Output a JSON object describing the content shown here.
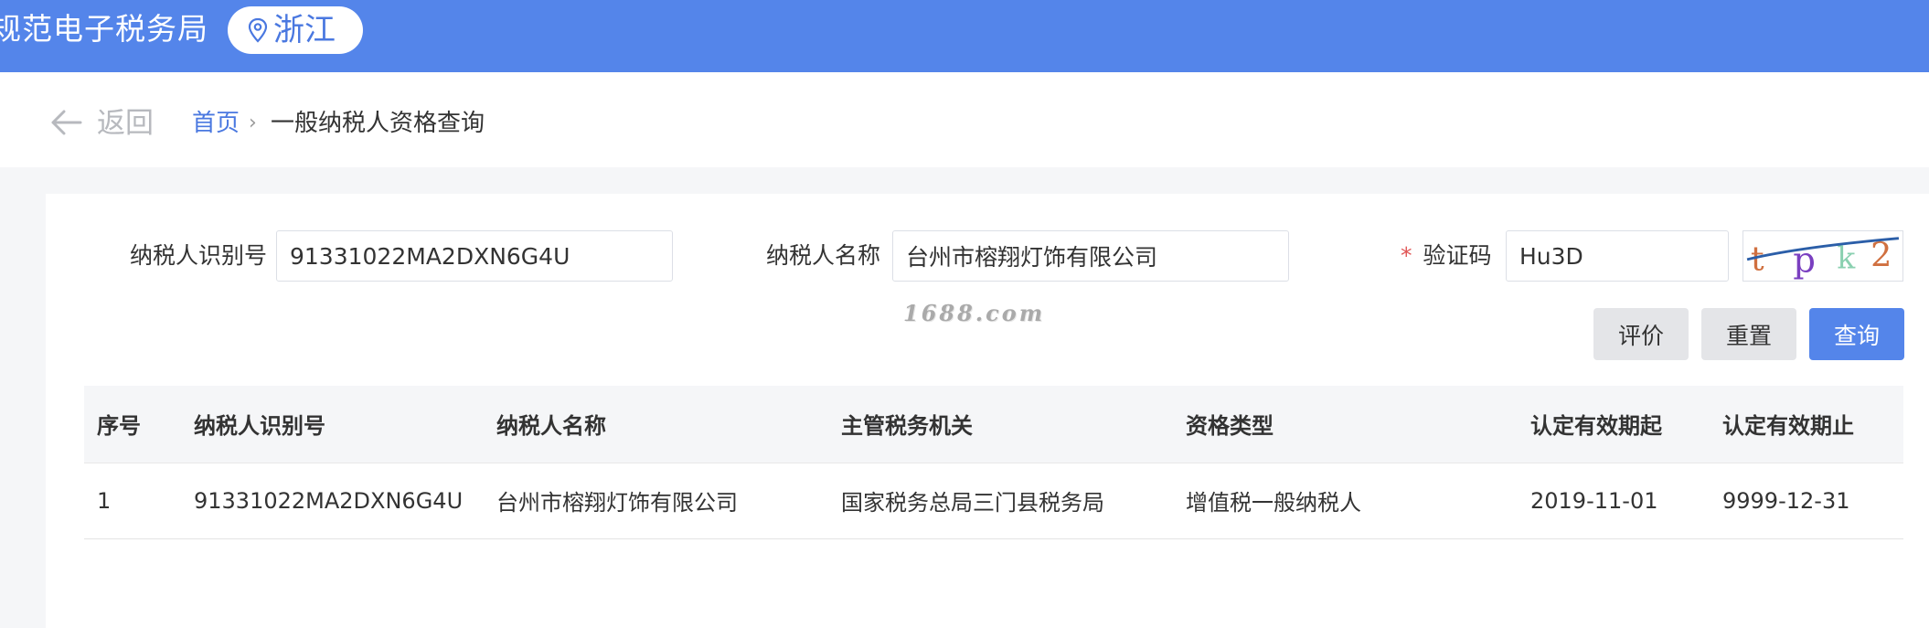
{
  "header": {
    "site_title": "规范电子税务局",
    "region": "浙江",
    "brand_color": "#5485ea",
    "region_icon": "location-pin-icon"
  },
  "nav": {
    "back_label": "返回",
    "back_icon": "arrow-left-icon",
    "breadcrumb_home": "首页",
    "breadcrumb_separator": "›",
    "breadcrumb_current": "一般纳税人资格查询"
  },
  "form": {
    "taxpayer_id_label": "纳税人识别号",
    "taxpayer_id_value": "91331022MA2DXN6G4U",
    "taxpayer_name_label": "纳税人名称",
    "taxpayer_name_value": "台州市榕翔灯饰有限公司",
    "captcha_required_mark": "*",
    "captcha_label": "验证码",
    "captcha_value": "Hu3D",
    "captcha_image_text": "tpk2"
  },
  "watermark": "1688.com",
  "buttons": {
    "evaluate": "评价",
    "reset": "重置",
    "query": "查询"
  },
  "table": {
    "columns": [
      "序号",
      "纳税人识别号",
      "纳税人名称",
      "主管税务机关",
      "资格类型",
      "认定有效期起",
      "认定有效期止"
    ],
    "rows": [
      [
        "1",
        "91331022MA2DXN6G4U",
        "台州市榕翔灯饰有限公司",
        "国家税务总局三门县税务局",
        "增值税一般纳税人",
        "2019-11-01",
        "9999-12-31"
      ]
    ]
  }
}
